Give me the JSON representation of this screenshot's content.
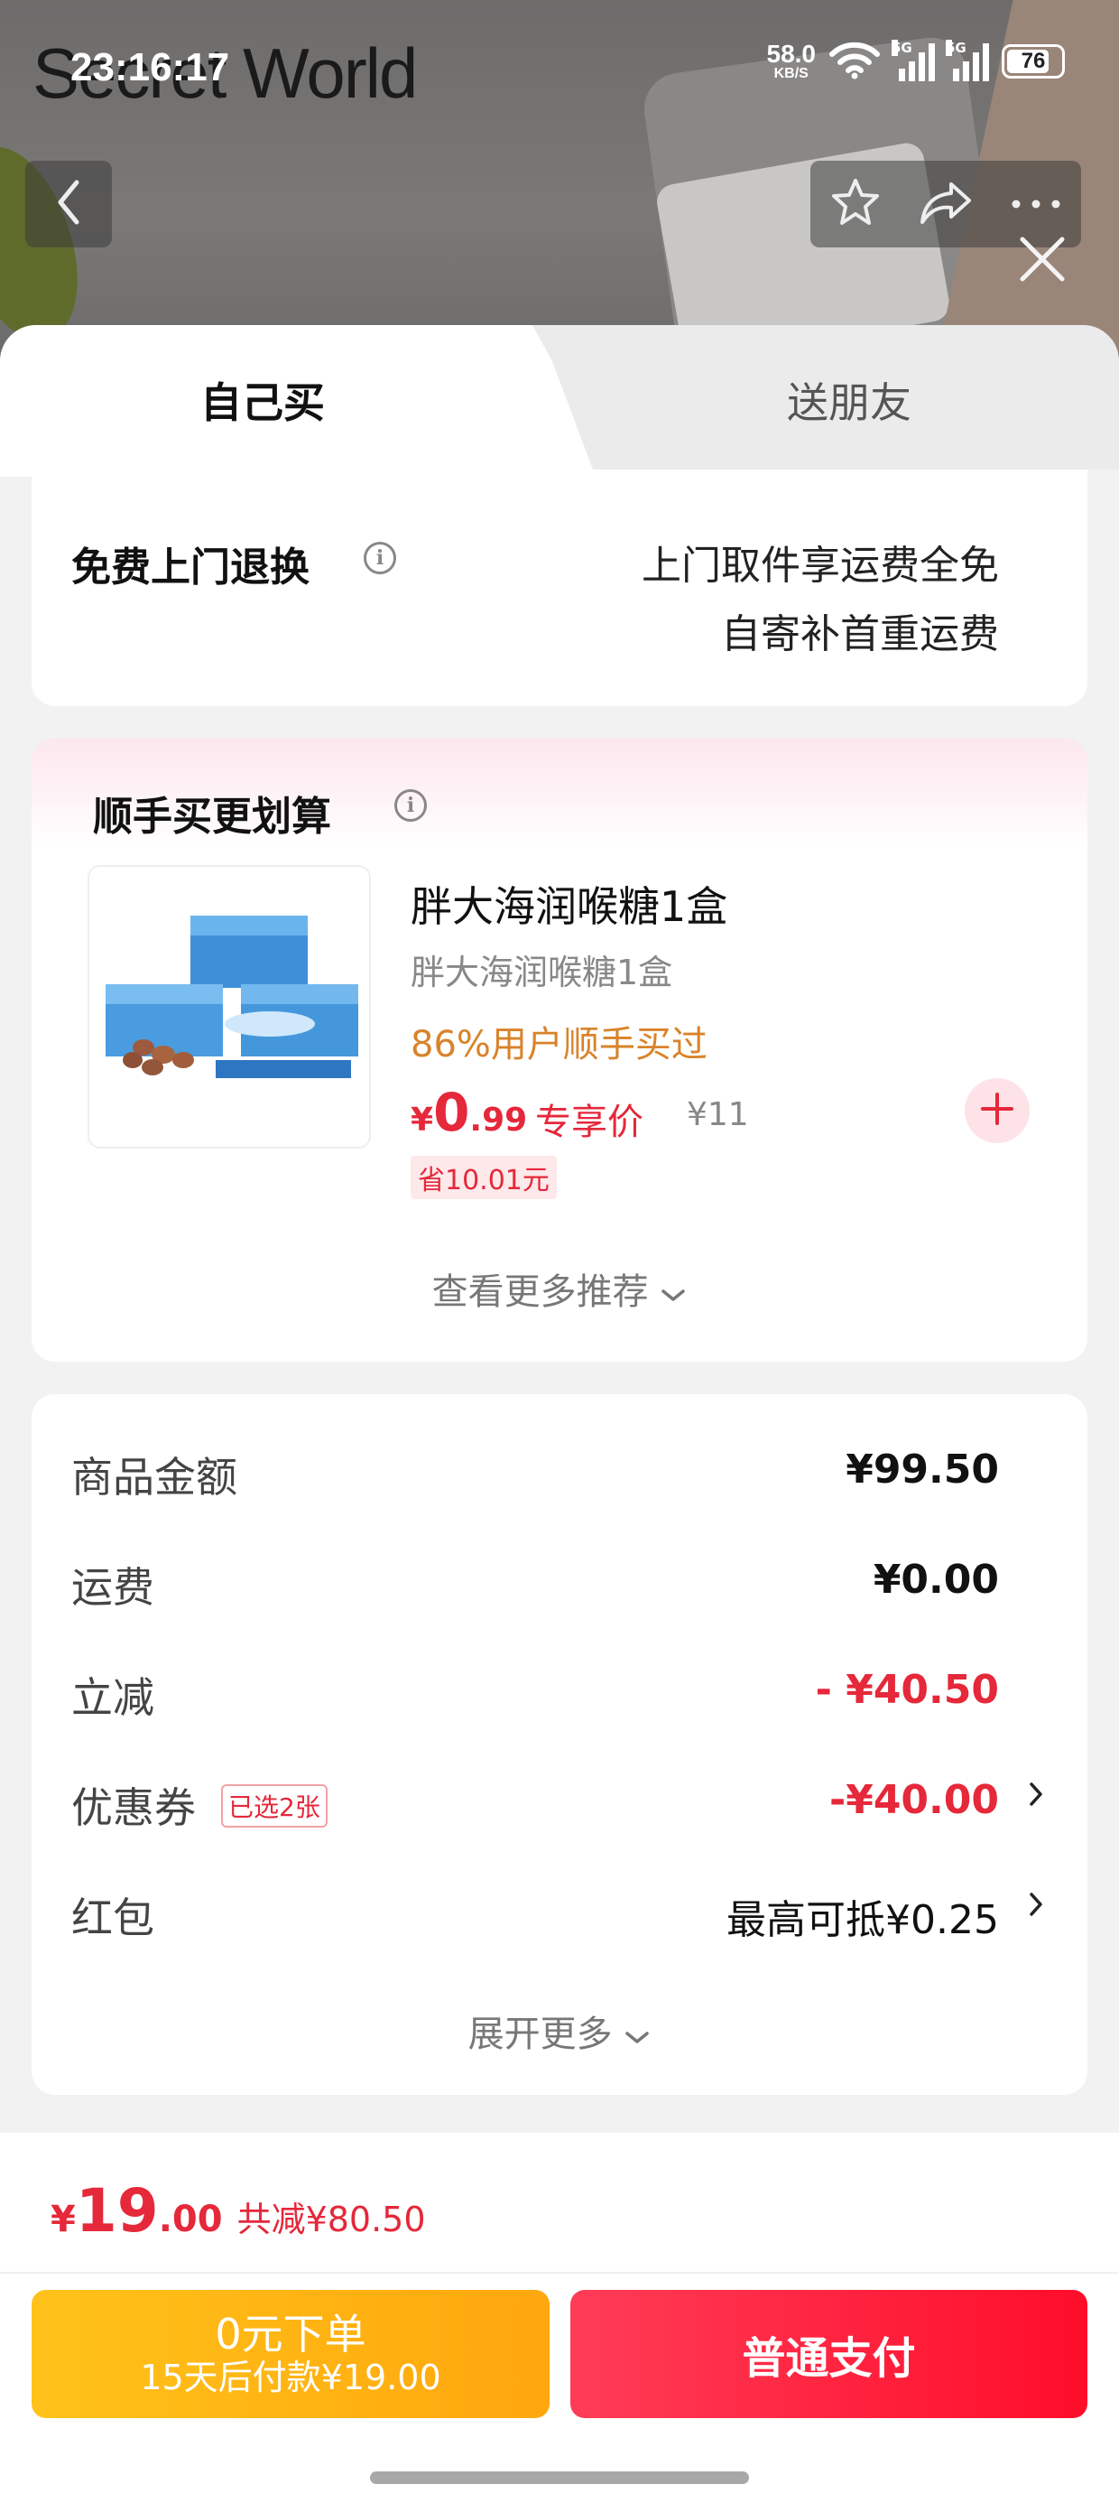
{
  "status_bar": {
    "time": "23:16:17",
    "net_speed_value": "58.0",
    "net_speed_unit": "KB/S",
    "signal1_label": "5G",
    "signal2_label": "5G",
    "battery": "76"
  },
  "background": {
    "brand": "Secret World"
  },
  "tabs": {
    "self": "自己买",
    "friend": "送朋友"
  },
  "return_service": {
    "title": "免费上门退换",
    "line1": "上门取件享运费全免",
    "line2": "自寄补首重运费"
  },
  "recommendation": {
    "title": "顺手买更划算",
    "product": {
      "name": "胖大海润喉糖1盒",
      "subtitle": "胖大海润喉糖1盒",
      "buyers": "86%用户顺手买过",
      "price_symbol": "¥",
      "price_int": "0",
      "price_dec": ".99",
      "exclusive_label": "专享价",
      "original_price": "¥11",
      "saving": "省10.01元"
    },
    "more": "查看更多推荐"
  },
  "summary": {
    "goods_label": "商品金额",
    "goods_value": "¥99.50",
    "shipping_label": "运费",
    "shipping_value": "¥0.00",
    "discount_label": "立减",
    "discount_value": "- ¥40.50",
    "coupon_label": "优惠券",
    "coupon_tag": "已选2张",
    "coupon_value": "-¥40.00",
    "redpacket_label": "红包",
    "redpacket_value": "最高可抵¥0.25",
    "expand": "展开更多"
  },
  "checkout": {
    "total_symbol": "¥",
    "total_int": "19",
    "total_dec": ".00",
    "total_saved": "共减¥80.50",
    "credit_button_main": "0元下单",
    "credit_button_sub": "15天后付款¥19.00",
    "pay_button": "普通支付"
  },
  "colors": {
    "accent_red": "#e5283a",
    "credit_yellow": "#ffb31a",
    "buyers_orange": "#d9832a"
  }
}
